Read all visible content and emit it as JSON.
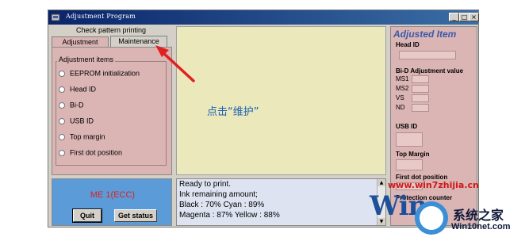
{
  "window": {
    "title": "Adjustment Program"
  },
  "titlebar_buttons": {
    "minimize": "_",
    "maximize": "□",
    "close": "×"
  },
  "check_pattern": "Check pattern printing",
  "tabs": [
    {
      "label": "Adjustment"
    },
    {
      "label": "Maintenance"
    }
  ],
  "adjustment_items": {
    "title": "Adjustment items",
    "items": [
      "EEPROM initialization",
      "Head ID",
      "Bi-D",
      "USB ID",
      "Top margin",
      "First dot position"
    ]
  },
  "center": {
    "hint": "点击“维护”"
  },
  "right_panel": {
    "title": "Adjusted Item",
    "head_id": "Head ID",
    "bid": "Bi-D Adjustment value",
    "ms1": "MS1",
    "ms2": "MS2",
    "vs": "VS",
    "nd": "ND",
    "usb_id": "USB ID",
    "top_margin": "Top Margin",
    "first_dot": "First dot position",
    "protection": "Protection counter"
  },
  "bottom_left": {
    "model": "ME 1(ECC)",
    "quit": "Quit",
    "get_status": "Get status"
  },
  "status": {
    "line1": "Ready to print.",
    "line2": "Ink remaining amount;",
    "line3": "Black : 70% Cyan : 89%",
    "line4": "Magenta : 87% Yellow : 88%"
  },
  "watermark": {
    "url_top": "www.win7zhijia.cn",
    "logo": "Win",
    "cn": "系统之家",
    "url": "Win10net.com"
  },
  "colors": {
    "title_bar": "#0a246a",
    "panel_pink": "#dbb4b4",
    "panel_yellow": "#ebe8bc",
    "panel_blue": "#5a9bd8",
    "accent_red": "#e02020",
    "arrow_red": "#e02020"
  }
}
